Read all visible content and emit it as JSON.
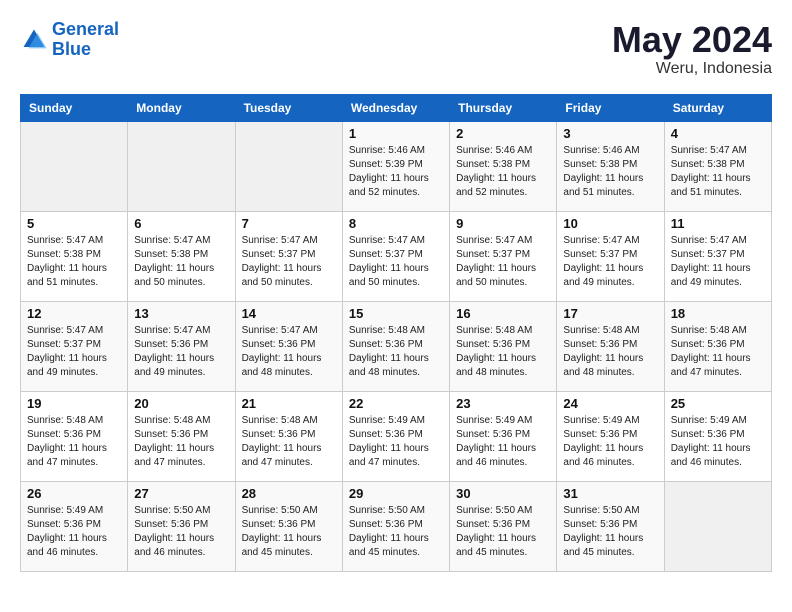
{
  "header": {
    "logo_line1": "General",
    "logo_line2": "Blue",
    "month": "May 2024",
    "location": "Weru, Indonesia"
  },
  "weekdays": [
    "Sunday",
    "Monday",
    "Tuesday",
    "Wednesday",
    "Thursday",
    "Friday",
    "Saturday"
  ],
  "weeks": [
    [
      {
        "day": "",
        "info": ""
      },
      {
        "day": "",
        "info": ""
      },
      {
        "day": "",
        "info": ""
      },
      {
        "day": "1",
        "info": "Sunrise: 5:46 AM\nSunset: 5:39 PM\nDaylight: 11 hours\nand 52 minutes."
      },
      {
        "day": "2",
        "info": "Sunrise: 5:46 AM\nSunset: 5:38 PM\nDaylight: 11 hours\nand 52 minutes."
      },
      {
        "day": "3",
        "info": "Sunrise: 5:46 AM\nSunset: 5:38 PM\nDaylight: 11 hours\nand 51 minutes."
      },
      {
        "day": "4",
        "info": "Sunrise: 5:47 AM\nSunset: 5:38 PM\nDaylight: 11 hours\nand 51 minutes."
      }
    ],
    [
      {
        "day": "5",
        "info": "Sunrise: 5:47 AM\nSunset: 5:38 PM\nDaylight: 11 hours\nand 51 minutes."
      },
      {
        "day": "6",
        "info": "Sunrise: 5:47 AM\nSunset: 5:38 PM\nDaylight: 11 hours\nand 50 minutes."
      },
      {
        "day": "7",
        "info": "Sunrise: 5:47 AM\nSunset: 5:37 PM\nDaylight: 11 hours\nand 50 minutes."
      },
      {
        "day": "8",
        "info": "Sunrise: 5:47 AM\nSunset: 5:37 PM\nDaylight: 11 hours\nand 50 minutes."
      },
      {
        "day": "9",
        "info": "Sunrise: 5:47 AM\nSunset: 5:37 PM\nDaylight: 11 hours\nand 50 minutes."
      },
      {
        "day": "10",
        "info": "Sunrise: 5:47 AM\nSunset: 5:37 PM\nDaylight: 11 hours\nand 49 minutes."
      },
      {
        "day": "11",
        "info": "Sunrise: 5:47 AM\nSunset: 5:37 PM\nDaylight: 11 hours\nand 49 minutes."
      }
    ],
    [
      {
        "day": "12",
        "info": "Sunrise: 5:47 AM\nSunset: 5:37 PM\nDaylight: 11 hours\nand 49 minutes."
      },
      {
        "day": "13",
        "info": "Sunrise: 5:47 AM\nSunset: 5:36 PM\nDaylight: 11 hours\nand 49 minutes."
      },
      {
        "day": "14",
        "info": "Sunrise: 5:47 AM\nSunset: 5:36 PM\nDaylight: 11 hours\nand 48 minutes."
      },
      {
        "day": "15",
        "info": "Sunrise: 5:48 AM\nSunset: 5:36 PM\nDaylight: 11 hours\nand 48 minutes."
      },
      {
        "day": "16",
        "info": "Sunrise: 5:48 AM\nSunset: 5:36 PM\nDaylight: 11 hours\nand 48 minutes."
      },
      {
        "day": "17",
        "info": "Sunrise: 5:48 AM\nSunset: 5:36 PM\nDaylight: 11 hours\nand 48 minutes."
      },
      {
        "day": "18",
        "info": "Sunrise: 5:48 AM\nSunset: 5:36 PM\nDaylight: 11 hours\nand 47 minutes."
      }
    ],
    [
      {
        "day": "19",
        "info": "Sunrise: 5:48 AM\nSunset: 5:36 PM\nDaylight: 11 hours\nand 47 minutes."
      },
      {
        "day": "20",
        "info": "Sunrise: 5:48 AM\nSunset: 5:36 PM\nDaylight: 11 hours\nand 47 minutes."
      },
      {
        "day": "21",
        "info": "Sunrise: 5:48 AM\nSunset: 5:36 PM\nDaylight: 11 hours\nand 47 minutes."
      },
      {
        "day": "22",
        "info": "Sunrise: 5:49 AM\nSunset: 5:36 PM\nDaylight: 11 hours\nand 47 minutes."
      },
      {
        "day": "23",
        "info": "Sunrise: 5:49 AM\nSunset: 5:36 PM\nDaylight: 11 hours\nand 46 minutes."
      },
      {
        "day": "24",
        "info": "Sunrise: 5:49 AM\nSunset: 5:36 PM\nDaylight: 11 hours\nand 46 minutes."
      },
      {
        "day": "25",
        "info": "Sunrise: 5:49 AM\nSunset: 5:36 PM\nDaylight: 11 hours\nand 46 minutes."
      }
    ],
    [
      {
        "day": "26",
        "info": "Sunrise: 5:49 AM\nSunset: 5:36 PM\nDaylight: 11 hours\nand 46 minutes."
      },
      {
        "day": "27",
        "info": "Sunrise: 5:50 AM\nSunset: 5:36 PM\nDaylight: 11 hours\nand 46 minutes."
      },
      {
        "day": "28",
        "info": "Sunrise: 5:50 AM\nSunset: 5:36 PM\nDaylight: 11 hours\nand 45 minutes."
      },
      {
        "day": "29",
        "info": "Sunrise: 5:50 AM\nSunset: 5:36 PM\nDaylight: 11 hours\nand 45 minutes."
      },
      {
        "day": "30",
        "info": "Sunrise: 5:50 AM\nSunset: 5:36 PM\nDaylight: 11 hours\nand 45 minutes."
      },
      {
        "day": "31",
        "info": "Sunrise: 5:50 AM\nSunset: 5:36 PM\nDaylight: 11 hours\nand 45 minutes."
      },
      {
        "day": "",
        "info": ""
      }
    ]
  ]
}
